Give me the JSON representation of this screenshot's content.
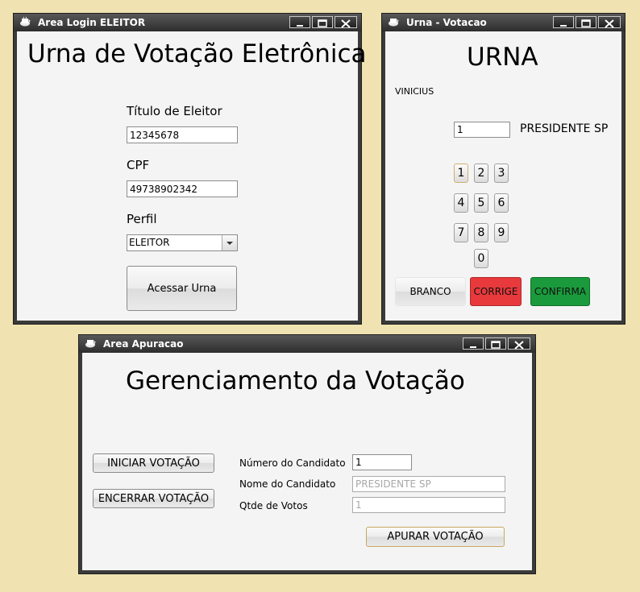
{
  "login": {
    "window_title": "Area Login ELEITOR",
    "heading": "Urna de Votação Eletrônica",
    "titulo_label": "Título de Eleitor",
    "titulo_value": "12345678",
    "cpf_label": "CPF",
    "cpf_value": "49738902342",
    "perfil_label": "Perfil",
    "perfil_value": "ELEITOR",
    "access_button": "Acessar Urna"
  },
  "urna": {
    "window_title": "Urna - Votacao",
    "heading": "URNA",
    "voter_name": "VINICIUS",
    "number_value": "1",
    "candidate_name": "PRESIDENTE SP",
    "keys": [
      "1",
      "2",
      "3",
      "4",
      "5",
      "6",
      "7",
      "8",
      "9",
      "0"
    ],
    "branco": "BRANCO",
    "corrige": "CORRIGE",
    "confirma": "CONFIRMA",
    "colors": {
      "corrige": "#e8393c",
      "confirma": "#1a9a3c"
    }
  },
  "apuracao": {
    "window_title": "Area Apuracao",
    "heading": "Gerenciamento da Votação",
    "iniciar": "INICIAR VOTAÇÃO",
    "encerrar": "ENCERRAR VOTAÇÃO",
    "numero_label": "Número do Candidato",
    "numero_value": "1",
    "nome_label": "Nome do Candidato",
    "nome_value": "PRESIDENTE SP",
    "votos_label": "Qtde de Votos",
    "votos_value": "1",
    "apurar": "APURAR VOTAÇÃO"
  },
  "icons": [
    "app-icon",
    "minimize-icon",
    "maximize-icon",
    "close-icon",
    "dropdown-arrow-icon"
  ]
}
